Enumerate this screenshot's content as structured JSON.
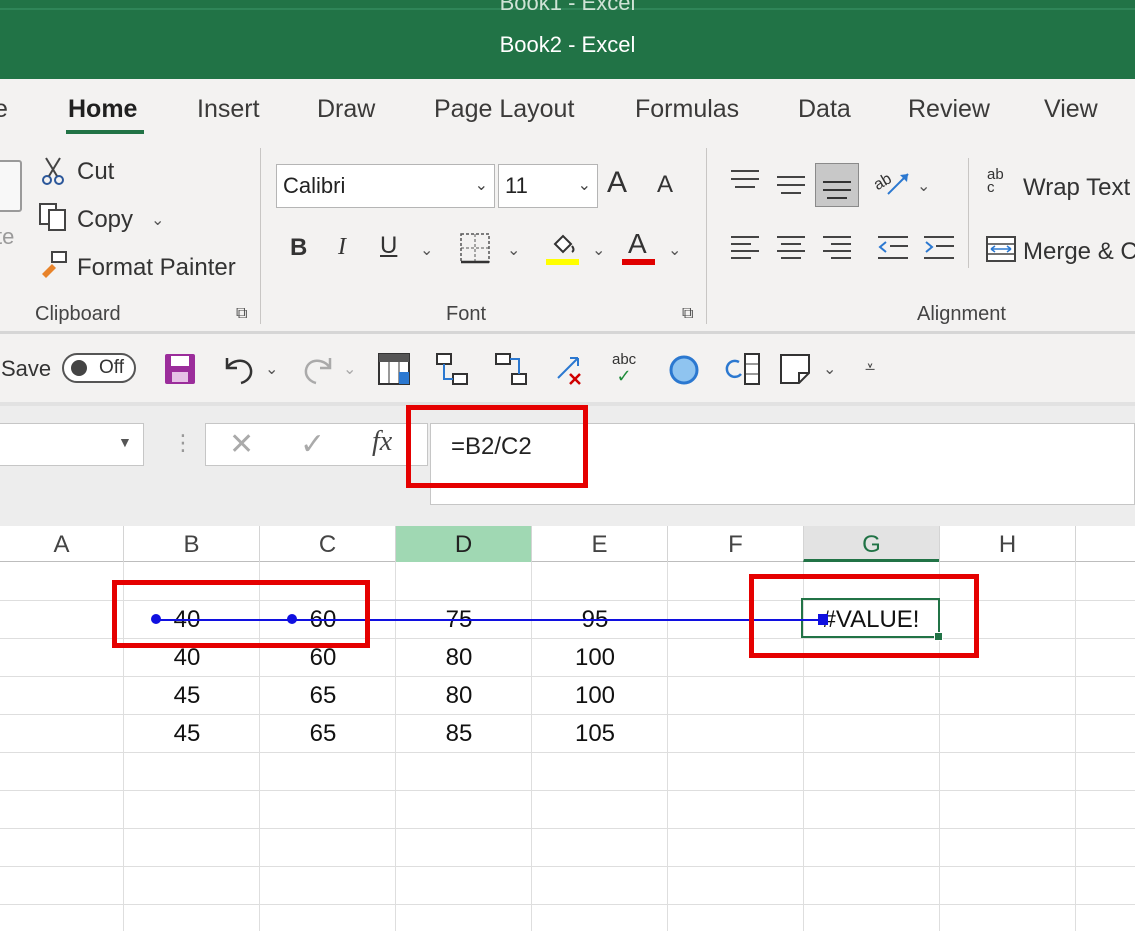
{
  "window": {
    "background_title": "Book1  -  Excel",
    "title": "Book2  -  Excel"
  },
  "tabs": [
    {
      "label": "e",
      "active": false
    },
    {
      "label": "Home",
      "active": true
    },
    {
      "label": "Insert",
      "active": false
    },
    {
      "label": "Draw",
      "active": false
    },
    {
      "label": "Page Layout",
      "active": false
    },
    {
      "label": "Formulas",
      "active": false
    },
    {
      "label": "Data",
      "active": false
    },
    {
      "label": "Review",
      "active": false
    },
    {
      "label": "View",
      "active": false
    }
  ],
  "clipboard": {
    "paste_label": "te",
    "cut": "Cut",
    "copy": "Copy",
    "format_painter": "Format Painter",
    "group_label": "Clipboard"
  },
  "font": {
    "family": "Calibri",
    "size": "11",
    "group_label": "Font",
    "grow_glyph": "A",
    "shrink_glyph": "A",
    "bold_glyph": "B",
    "italic_glyph": "I",
    "underline_glyph": "U",
    "font_color_glyph": "A",
    "highlight_color": "#ffff00",
    "font_color": "#e00000"
  },
  "alignment": {
    "wrap_text": "Wrap Text",
    "merge": "Merge & C",
    "group_label": "Alignment",
    "wrap_icon_text": "ab c"
  },
  "qat": {
    "autosave_label": "Save",
    "toggle_state": "Off",
    "spelling_icon_text": "abc"
  },
  "formula_bar": {
    "fx_label": "fx",
    "formula": "=B2/C2"
  },
  "grid": {
    "columns": [
      "A",
      "B",
      "C",
      "D",
      "E",
      "F",
      "G",
      "H"
    ],
    "rows": [
      {
        "B": "40",
        "C": "60",
        "D": "75",
        "E": "95",
        "G": "#VALUE!"
      },
      {
        "B": "40",
        "C": "60",
        "D": "80",
        "E": "100"
      },
      {
        "B": "45",
        "C": "65",
        "D": "80",
        "E": "100"
      },
      {
        "B": "45",
        "C": "65",
        "D": "85",
        "E": "105"
      }
    ]
  },
  "colors": {
    "excel_green": "#217346",
    "highlight_red": "#e50000",
    "trace_blue": "#1010e0"
  }
}
